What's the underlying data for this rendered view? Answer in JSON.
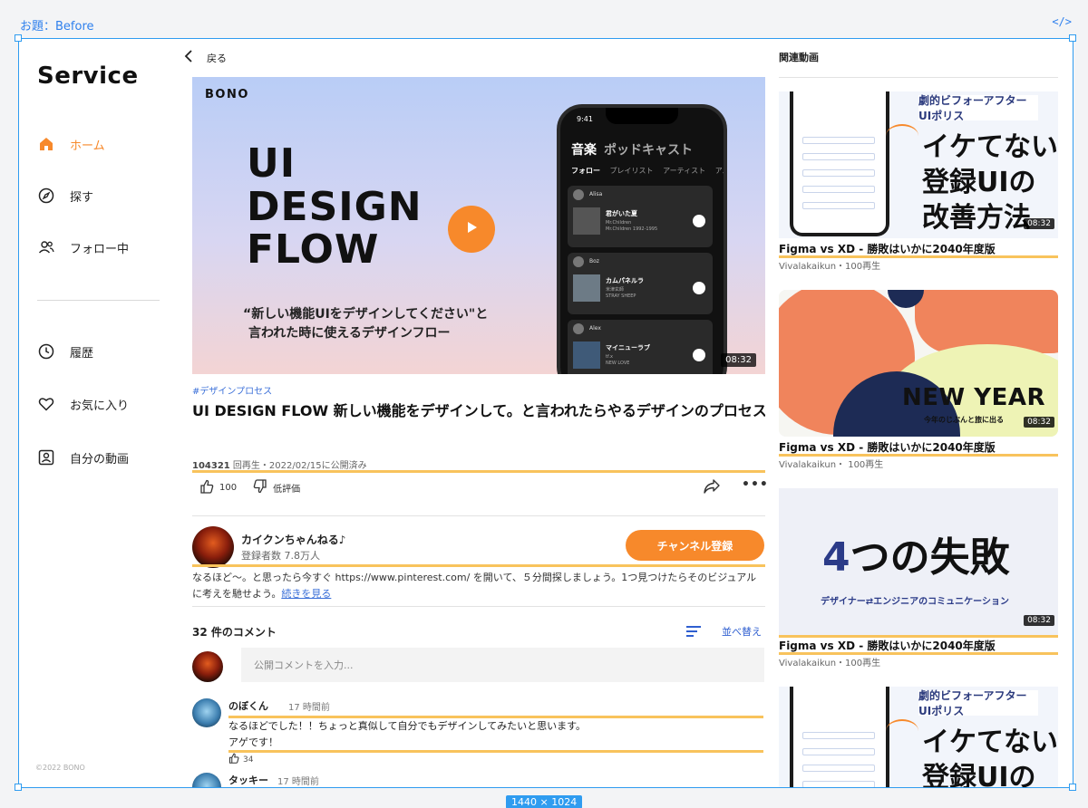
{
  "frame": {
    "label": "お題：Before",
    "code_icon": "</>",
    "size": "1440 × 1024"
  },
  "sidebar": {
    "logo": "Service",
    "items": [
      {
        "label": "ホーム",
        "icon": "home-icon",
        "active": true
      },
      {
        "label": "探す",
        "icon": "compass-icon",
        "active": false
      },
      {
        "label": "フォロー中",
        "icon": "people-icon",
        "active": false
      },
      {
        "label": "履歴",
        "icon": "clock-icon",
        "active": false
      },
      {
        "label": "お気に入り",
        "icon": "heart-icon",
        "active": false
      },
      {
        "label": "自分の動画",
        "icon": "user-square-icon",
        "active": false
      }
    ],
    "copyright": "©2022 BONO"
  },
  "main": {
    "back_label": "戻る",
    "video": {
      "brand": "BONO",
      "title_lines": [
        "UI",
        "DESIGN",
        "FLOW"
      ],
      "subtitle_lines": [
        "“新しい機能UIをデザインしてください\"と",
        "言われた時に使えるデザインフロー"
      ],
      "duration": "08:32",
      "phone": {
        "time": "9:41",
        "tab_main": "音楽",
        "tab_other": "ポッドキャスト",
        "subtabs": [
          "フォロー",
          "プレイリスト",
          "アーティスト",
          "アル"
        ],
        "cards": [
          {
            "user": "Alisa",
            "song": "君がいた夏",
            "artist": "Mr.Children",
            "album": "Mr.Children 1992-1995"
          },
          {
            "user": "Boz",
            "song": "カムパネルラ",
            "artist": "米津玄師",
            "album": "STRAY SHEEP"
          },
          {
            "user": "Alex",
            "song": "マイニューラブ",
            "artist": "tf.x",
            "album": "NEW LOVE"
          }
        ]
      }
    },
    "tag": "#デザインプロセス",
    "title": "UI DESIGN FLOW 新しい機能をデザインして。と言われたらやるデザインのプロセス",
    "views": "104321",
    "meta_rest": " 回再生・2022/02/15に公開済み",
    "likes": "100",
    "dislike_label": "低評価",
    "channel": {
      "name": "カイクンちゃんねる♪",
      "subscribers": "登録者数 7.8万人",
      "subscribe_label": "チャンネル登録"
    },
    "description": "なるほど〜。と思ったら今すぐ https://www.pinterest.com/ を開いて、５分間探しましょう。1つ見つけたらそのビジュアルに考えを馳せよう。",
    "read_more": "続きを見る",
    "comments": {
      "count_label": "32 件のコメント",
      "sort_label": "並べ替え",
      "input_placeholder": "公開コメントを入力...",
      "items": [
        {
          "name": "のぼくん",
          "time": "17 時間前",
          "text_lines": [
            "なるほどでした！！ちょっと真似して自分でもデザインしてみたいと思います。",
            "アゲです！"
          ],
          "likes": "34"
        },
        {
          "name": "タッキー",
          "time": "17 時間前",
          "text_lines": [],
          "likes": ""
        }
      ]
    }
  },
  "related": {
    "heading": "関連動画",
    "items": [
      {
        "title": "Figma vs XD - 勝敗はいかに2040年度版",
        "channel": "Vivalakaikun・100再生",
        "duration": "08:32",
        "thumb_badge": "劇的ビフォーアフター UIポリス",
        "thumb_text": [
          "イケてない",
          "登録UIの",
          "改善方法"
        ]
      },
      {
        "title": "Figma vs XD - 勝敗はいかに2040年度版",
        "channel": "Vivalakaikun・ 100再生",
        "duration": "08:32",
        "thumb_text": [
          "NEW YEAR"
        ],
        "thumb_sub": "今年のじぶんと旅に出る"
      },
      {
        "title": "Figma vs XD - 勝敗はいかに2040年度版",
        "channel": "Vivalakaikun・100再生",
        "duration": "08:32",
        "thumb_text": [
          "4",
          "つの失敗"
        ],
        "thumb_sub": "デザイナー⇄エンジニアのコミュニケーション"
      },
      {
        "title": "",
        "channel": "",
        "duration": "",
        "thumb_badge": "劇的ビフォーアフター UIポリス",
        "thumb_text": [
          "イケてない",
          "登録UIの"
        ]
      }
    ]
  },
  "colors": {
    "accent": "#f7892b",
    "highlight": "#f8c35c",
    "link": "#3a6fd8",
    "frame_blue": "#2f9cf0"
  }
}
